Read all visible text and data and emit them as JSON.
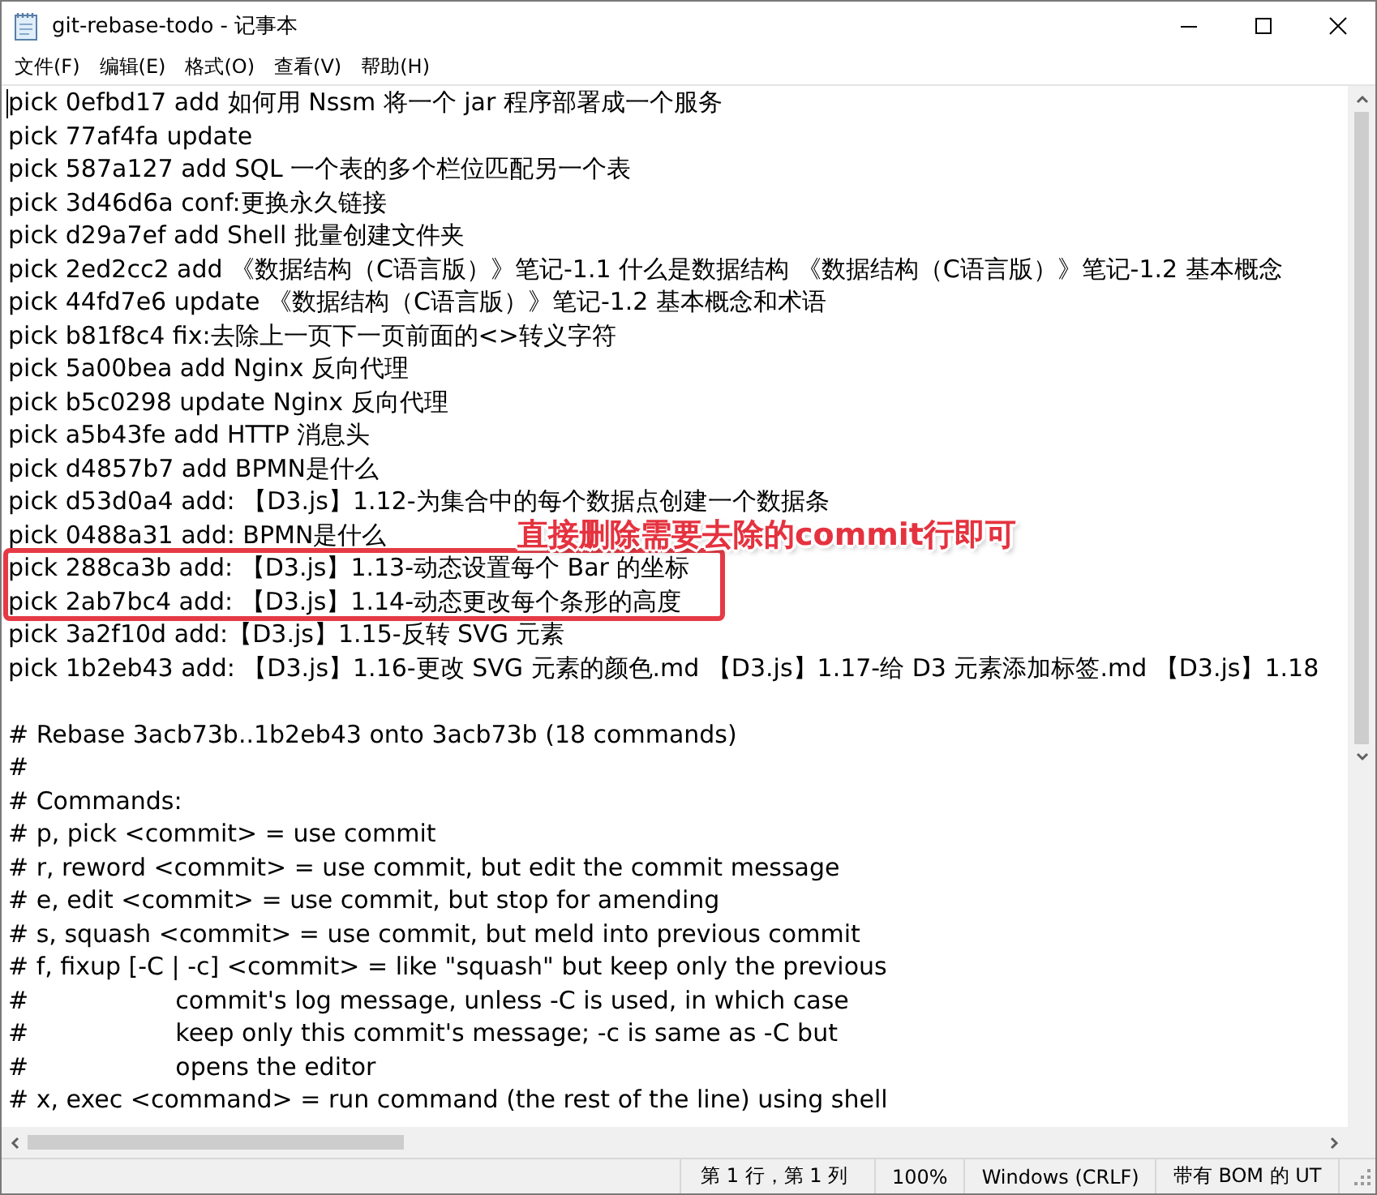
{
  "window": {
    "title": "git-rebase-todo - 记事本"
  },
  "menu": [
    "文件(F)",
    "编辑(E)",
    "格式(O)",
    "查看(V)",
    "帮助(H)"
  ],
  "editor": {
    "lines": [
      {
        "text": "pick 0efbd17 add 如何用 Nssm 将一个 jar 程序部署成一个服务",
        "boxed": false
      },
      {
        "text": "pick 77af4fa update",
        "boxed": false
      },
      {
        "text": "pick 587a127 add SQL 一个表的多个栏位匹配另一个表",
        "boxed": false
      },
      {
        "text": "pick 3d46d6a conf:更换永久链接",
        "boxed": false
      },
      {
        "text": "pick d29a7ef add Shell 批量创建文件夹",
        "boxed": false
      },
      {
        "text": "pick 2ed2cc2 add 《数据结构（C语言版）》笔记-1.1 什么是数据结构 《数据结构（C语言版）》笔记-1.2 基本概念",
        "boxed": false
      },
      {
        "text": "pick 44fd7e6 update 《数据结构（C语言版）》笔记-1.2 基本概念和术语",
        "boxed": false
      },
      {
        "text": "pick b81f8c4 fix:去除上一页下一页前面的<>转义字符",
        "boxed": false
      },
      {
        "text": "pick 5a00bea add Nginx 反向代理",
        "boxed": false
      },
      {
        "text": "pick b5c0298 update Nginx 反向代理",
        "boxed": false
      },
      {
        "text": "pick a5b43fe add HTTP 消息头",
        "boxed": false
      },
      {
        "text": "pick d4857b7 add BPMN是什么",
        "boxed": false
      },
      {
        "text": "pick d53d0a4 add: 【D3.js】1.12-为集合中的每个数据点创建一个数据条",
        "boxed": false
      },
      {
        "text": "pick 0488a31 add: BPMN是什么",
        "boxed": false
      },
      {
        "text": "pick 288ca3b add: 【D3.js】1.13-动态设置每个 Bar 的坐标",
        "boxed": true
      },
      {
        "text": "pick 2ab7bc4 add: 【D3.js】1.14-动态更改每个条形的高度",
        "boxed": true
      },
      {
        "text": "pick 3a2f10d add:【D3.js】1.15-反转 SVG 元素",
        "boxed": false
      },
      {
        "text": "pick 1b2eb43 add: 【D3.js】1.16-更改 SVG 元素的颜色.md 【D3.js】1.17-给 D3 元素添加标签.md 【D3.js】1.18",
        "boxed": false
      },
      {
        "boxed": false
      },
      {
        "text": "# Rebase 3acb73b..1b2eb43 onto 3acb73b (18 commands)",
        "boxed": false
      },
      {
        "text": "#",
        "boxed": false
      },
      {
        "text": "# Commands:",
        "boxed": false
      },
      {
        "text": "# p, pick <commit> = use commit",
        "boxed": false
      },
      {
        "text": "# r, reword <commit> = use commit, but edit the commit message",
        "boxed": false
      },
      {
        "text": "# e, edit <commit> = use commit, but stop for amending",
        "boxed": false
      },
      {
        "text": "# s, squash <commit> = use commit, but meld into previous commit",
        "boxed": false
      },
      {
        "text": "# f, fixup [-C | -c] <commit> = like \"squash\" but keep only the previous",
        "boxed": false
      },
      {
        "text": "#                   commit's log message, unless -C is used, in which case",
        "boxed": false
      },
      {
        "text": "#                   keep only this commit's message; -c is same as -C but",
        "boxed": false
      },
      {
        "text": "#                   opens the editor",
        "boxed": false
      },
      {
        "text": "# x, exec <command> = run command (the rest of the line) using shell",
        "boxed": false
      }
    ]
  },
  "annotation": {
    "text": "直接删除需要去除的commit行即可"
  },
  "status_bar": [
    "第 1 行，第 1 列",
    "100%",
    "Windows (CRLF)",
    "带有 BOM 的 UT"
  ]
}
